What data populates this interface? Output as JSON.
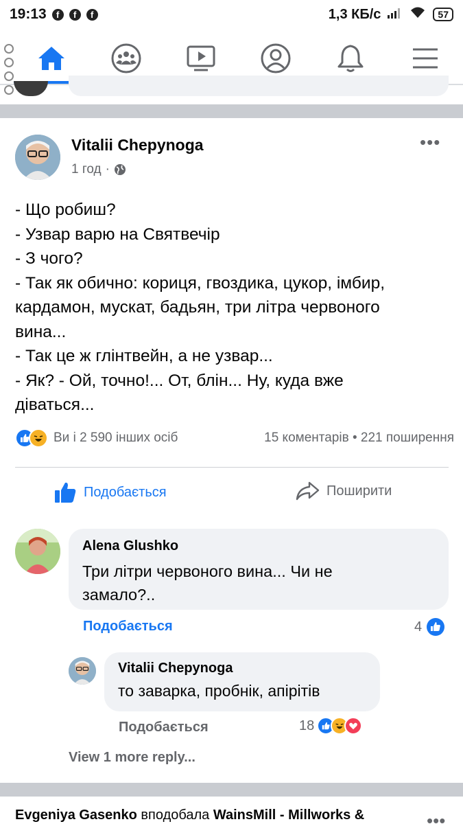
{
  "status_bar": {
    "time": "19:13",
    "speed": "1,3 КБ/с",
    "battery": "57"
  },
  "nav": {
    "items": [
      "home",
      "groups",
      "watch",
      "profile",
      "notifications",
      "menu"
    ],
    "active": "home",
    "accent_color": "#1877f2"
  },
  "post": {
    "author": "Vitalii Chepynoga",
    "time": "1 год",
    "privacy_icon": "globe-icon",
    "lines": [
      "- Що робиш?",
      "- Узвар варю на Святвечір",
      "- З чого?",
      "- Так як обично: кориця, гвоздика, цукор, імбир,",
      "кардамон, мускат, бадьян, три літра червоного",
      "вина...",
      "- Так це ж глінтвейн, а не узвар...",
      "- Як? - Ой, точно!... От, блін... Ну, куда вже",
      "діваться..."
    ],
    "reactions_text": "Ви і 2 590 інших осіб",
    "stats_text": "15 коментарів • 221 поширення",
    "like_label": "Подобається",
    "share_label": "Поширити"
  },
  "comments": [
    {
      "author": "Alena  Glushko",
      "text_lines": [
        "Три літри червоного вина... Чи не",
        "замало?.."
      ],
      "like_label": "Подобається",
      "reaction_count": "4"
    },
    {
      "author": "Vitalii Chepynoga",
      "text_lines": [
        "то заварка, пробнік, апірітів"
      ],
      "like_label": "Подобається",
      "reaction_count": "18"
    }
  ],
  "view_more": "View 1 more reply...",
  "next_story": {
    "actor": "Evgeniya  Gasenko",
    "verb": " вподобала ",
    "target": "WainsMill - Millworks &"
  }
}
